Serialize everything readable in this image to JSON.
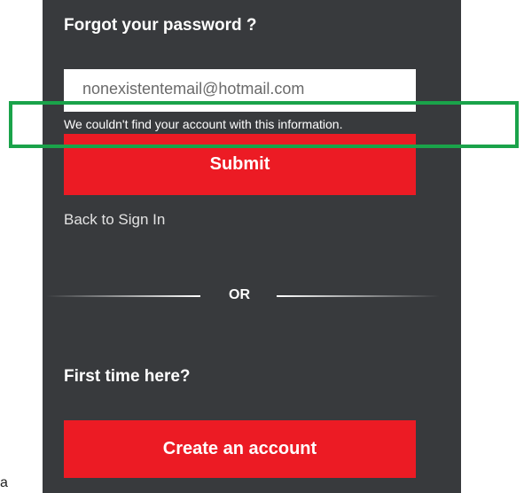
{
  "form": {
    "title": "Forgot your password ?",
    "email_value": "nonexistentemail@hotmail.com",
    "error_message": "We couldn't find your account with this information.",
    "submit_label": "Submit",
    "back_link": "Back to Sign In"
  },
  "divider": {
    "label": "OR"
  },
  "signup": {
    "heading": "First time here?",
    "create_label": "Create an account"
  },
  "page": {
    "stray_text": "a"
  },
  "colors": {
    "panel_bg": "#383a3d",
    "accent_red": "#ec1b24",
    "highlight_green": "#1aa34a"
  }
}
